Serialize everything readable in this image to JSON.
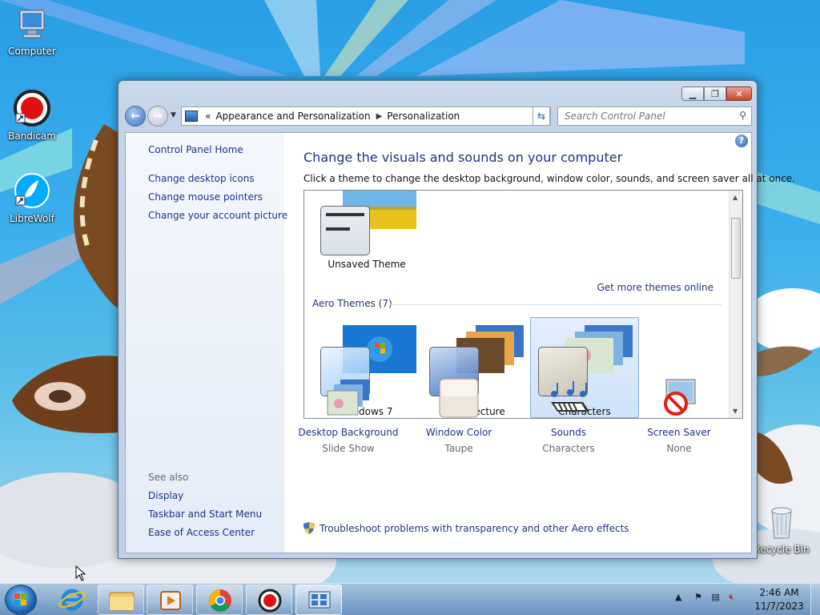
{
  "desktop": {
    "icons": [
      {
        "label": "Computer"
      },
      {
        "label": "Bandicam"
      },
      {
        "label": "LibreWolf"
      },
      {
        "label": "Recycle Bin"
      }
    ]
  },
  "window": {
    "address": {
      "overflow": "«",
      "segments": [
        "Appearance and Personalization",
        "Personalization"
      ]
    },
    "search_placeholder": "Search Control Panel",
    "left_pane": {
      "home": "Control Panel Home",
      "links": [
        "Change desktop icons",
        "Change mouse pointers",
        "Change your account picture"
      ],
      "see_also_heading": "See also",
      "see_also": [
        "Display",
        "Taskbar and Start Menu",
        "Ease of Access Center"
      ]
    },
    "main": {
      "title": "Change the visuals and sounds on your computer",
      "subtitle": "Click a theme to change the desktop background, window color, sounds, and screen saver all at once.",
      "unsaved_theme": "Unsaved Theme",
      "get_more_link": "Get more themes online",
      "aero_heading": "Aero Themes (7)",
      "aero_themes": [
        {
          "name": "Windows 7",
          "selected": false
        },
        {
          "name": "Architecture",
          "selected": false
        },
        {
          "name": "Characters",
          "selected": true
        }
      ],
      "settings": [
        {
          "label": "Desktop Background",
          "value": "Slide Show"
        },
        {
          "label": "Window Color",
          "value": "Taupe"
        },
        {
          "label": "Sounds",
          "value": "Characters"
        },
        {
          "label": "Screen Saver",
          "value": "None"
        }
      ],
      "troubleshoot": "Troubleshoot problems with transparency and other Aero effects"
    }
  },
  "taskbar": {
    "clock_time": "2:46 AM",
    "clock_date": "11/7/2023",
    "tray_chevron": "▲"
  },
  "colors": {
    "link": "#1e3287",
    "desktop_sky": "#2a9ee6",
    "selection": "#cfe2f9"
  }
}
